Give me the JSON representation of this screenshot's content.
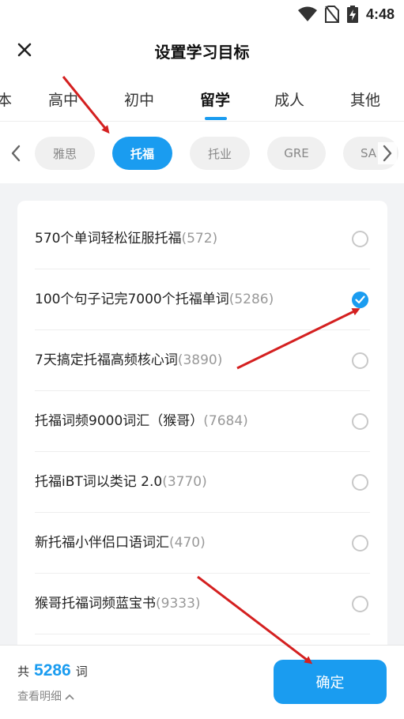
{
  "status_bar": {
    "time": "4:48"
  },
  "header": {
    "title": "设置学习目标"
  },
  "level_tabs": [
    {
      "label": "本"
    },
    {
      "label": "高中"
    },
    {
      "label": "初中"
    },
    {
      "label": "留学",
      "active": true
    },
    {
      "label": "成人"
    },
    {
      "label": "其他"
    }
  ],
  "exam_chips": [
    {
      "label": "雅思"
    },
    {
      "label": "托福",
      "active": true
    },
    {
      "label": "托业"
    },
    {
      "label": "GRE"
    },
    {
      "label": "SA"
    }
  ],
  "books": [
    {
      "name": "570个单词轻松征服托福",
      "count": "(572)",
      "checked": false
    },
    {
      "name": "100个句子记完7000个托福单词",
      "count": "(5286)",
      "checked": true
    },
    {
      "name": "7天搞定托福高频核心词",
      "count": "(3890)",
      "checked": false
    },
    {
      "name": "托福词频9000词汇（猴哥）",
      "count": "(7684)",
      "checked": false
    },
    {
      "name": "托福iBT词以类记 2.0",
      "count": "(3770)",
      "checked": false
    },
    {
      "name": "新托福小伴侣口语词汇",
      "count": "(470)",
      "checked": false
    },
    {
      "name": "猴哥托福词频蓝宝书",
      "count": "(9333)",
      "checked": false
    }
  ],
  "footer": {
    "total_prefix": "共",
    "total_count": "5286",
    "total_suffix": "词",
    "detail_label": "查看明细",
    "confirm_label": "确定"
  },
  "colors": {
    "accent": "#1a9cf0",
    "annotation_arrow": "#d42020"
  }
}
